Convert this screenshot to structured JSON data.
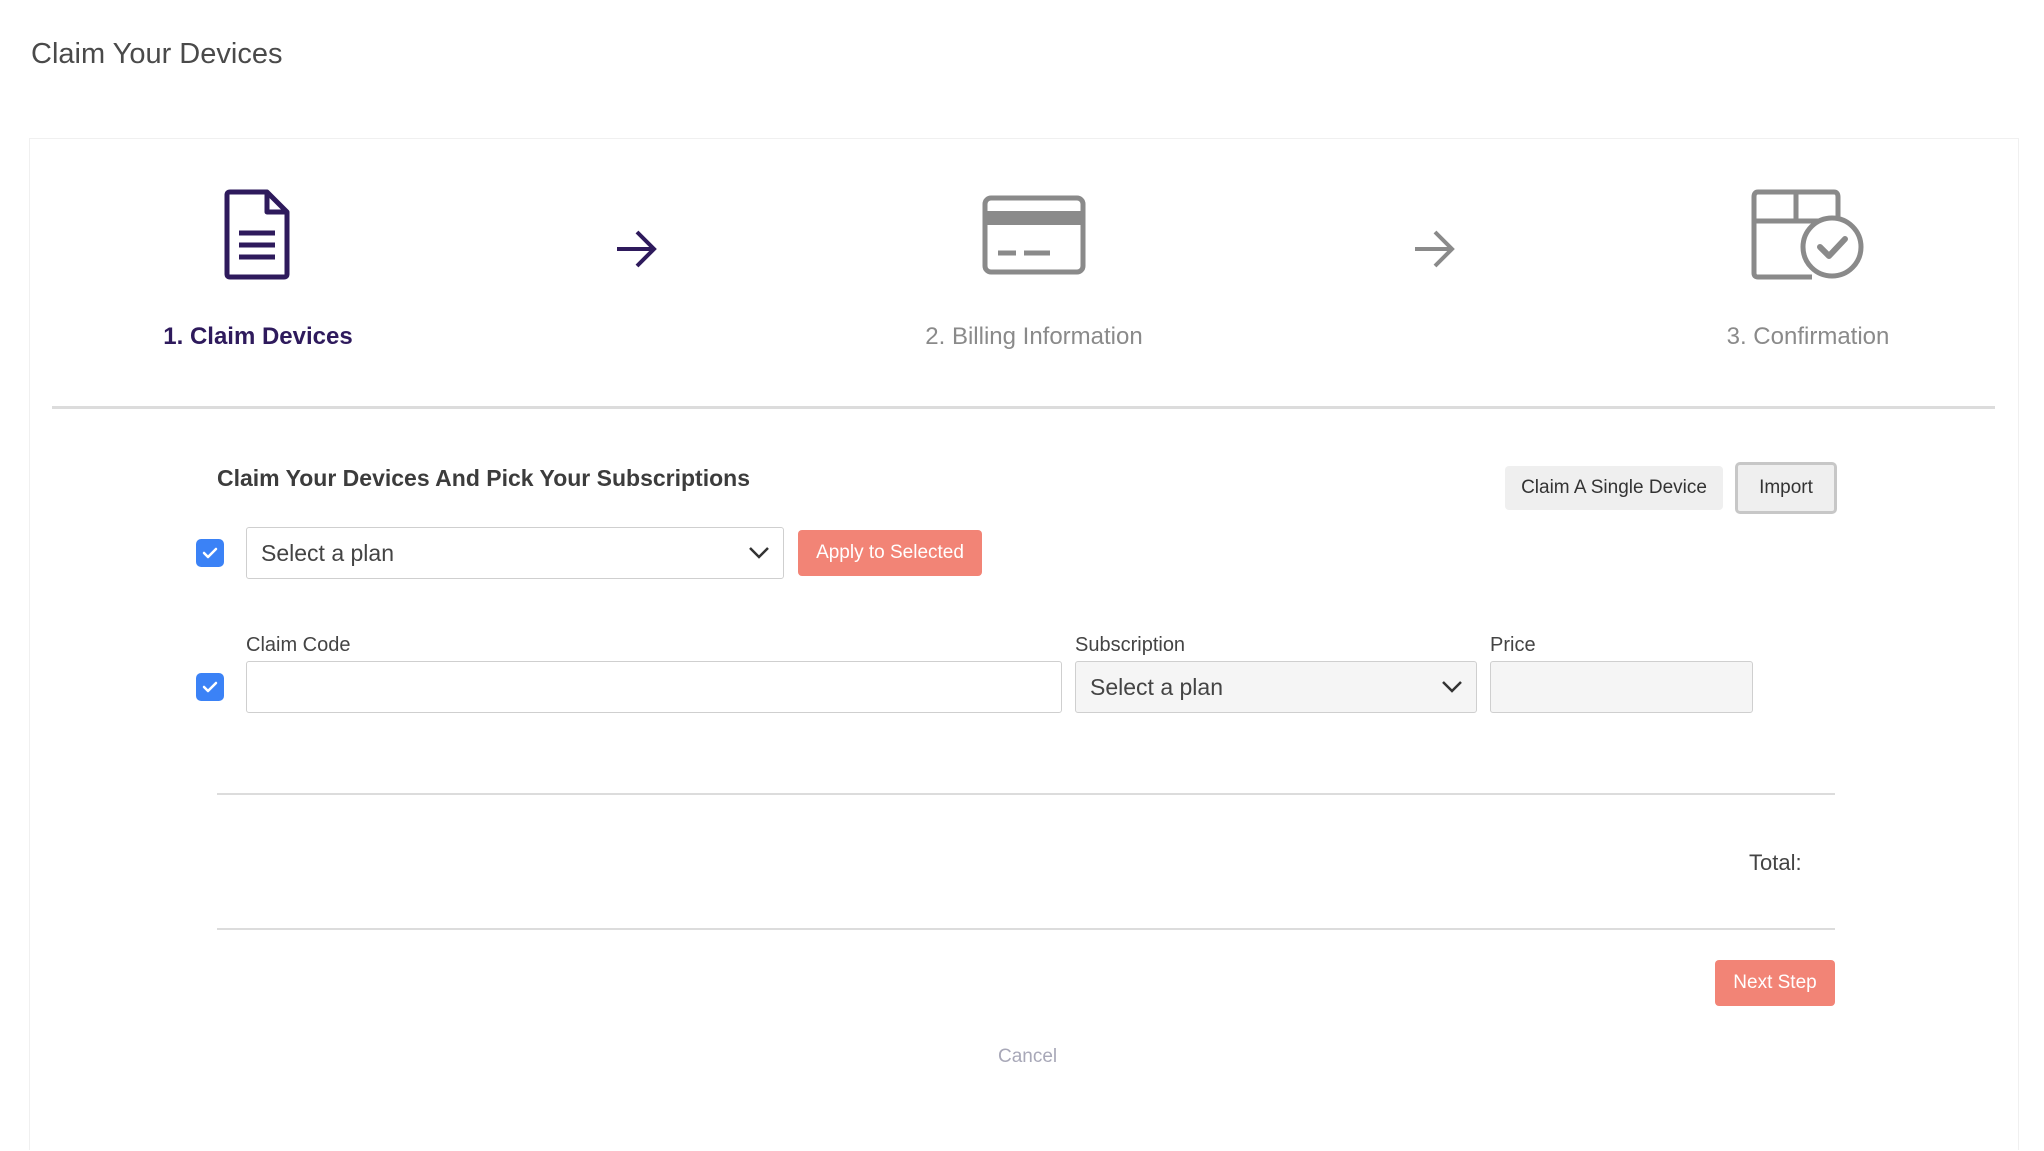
{
  "page": {
    "title": "Claim Your Devices"
  },
  "steps": [
    {
      "label": "1. Claim Devices",
      "icon": "document-icon",
      "state": "active"
    },
    {
      "label": "2. Billing Information",
      "icon": "credit-card-icon",
      "state": "inactive"
    },
    {
      "label": "3. Confirmation",
      "icon": "box-check-icon",
      "state": "inactive"
    }
  ],
  "main": {
    "section_title": "Claim Your Devices And Pick Your Subscriptions",
    "claim_single_label": "Claim A Single Device",
    "import_label": "Import",
    "bulk": {
      "select_placeholder": "Select a plan",
      "apply_label": "Apply to Selected",
      "checked": true
    },
    "row": {
      "claim_code_label": "Claim Code",
      "claim_code_value": "",
      "subscription_label": "Subscription",
      "subscription_value": "Select a plan",
      "price_label": "Price",
      "price_value": "",
      "checked": true
    },
    "total_label": "Total:",
    "next_label": "Next Step",
    "cancel_label": "Cancel"
  },
  "colors": {
    "accent": "#2e1a5c",
    "coral": "#f28476",
    "checkbox": "#3b82f6",
    "inactive": "#8a8a8a"
  }
}
